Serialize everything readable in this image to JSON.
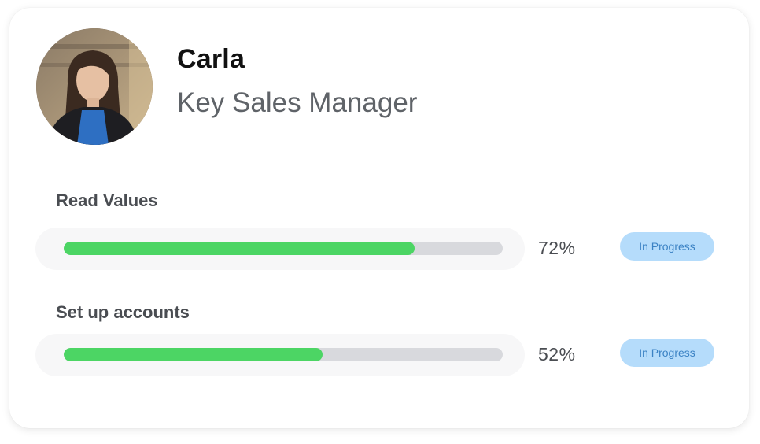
{
  "profile": {
    "name": "Carla",
    "role": "Key Sales Manager"
  },
  "tasks": [
    {
      "title": "Read Values",
      "progress": 0.8,
      "percent_label": "72%",
      "status": "In Progress"
    },
    {
      "title": "Set up accounts",
      "progress": 0.59,
      "percent_label": "52%",
      "status": "In Progress"
    }
  ],
  "colors": {
    "progress_fill": "#4cd564",
    "progress_track": "#d8d9dd",
    "badge_bg": "#b5dcfb",
    "badge_text": "#3b82c4"
  }
}
